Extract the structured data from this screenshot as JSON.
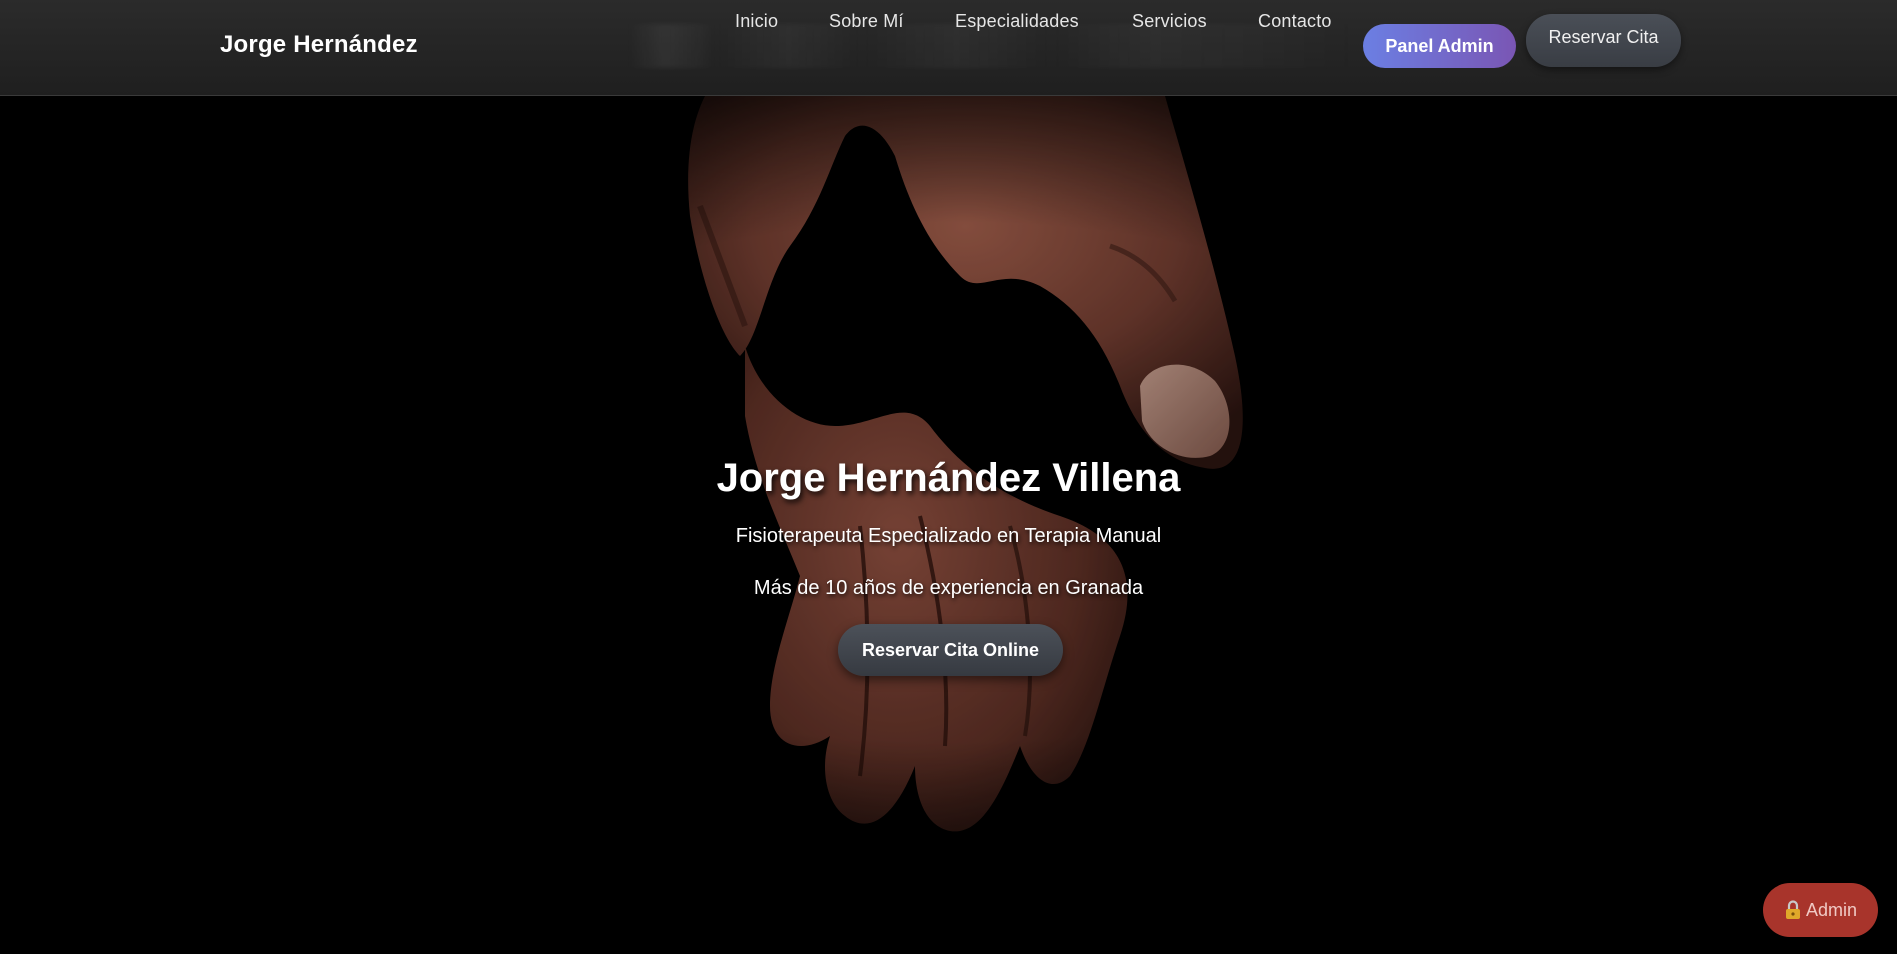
{
  "header": {
    "brand": "Jorge Hernández",
    "nav": [
      {
        "id": "inicio",
        "label": "Inicio"
      },
      {
        "id": "sobre-mi",
        "label": "Sobre Mí"
      },
      {
        "id": "especialidades",
        "label": "Especialidades"
      },
      {
        "id": "servicios",
        "label": "Servicios"
      },
      {
        "id": "contacto",
        "label": "Contacto"
      }
    ],
    "panel_admin_label": "Panel Admin",
    "reservar_label": "Reservar Cita"
  },
  "hero": {
    "title": "Jorge Hernández Villena",
    "subtitle": "Fisioterapeuta Especializado en Terapia Manual",
    "experience": "Más de 10 años de experiencia en Granada",
    "cta_label": "Reservar Cita Online",
    "background_icon": "hands-photo"
  },
  "floating_admin": {
    "icon": "lock-icon",
    "label": "Admin"
  },
  "colors": {
    "header_bg": "#252525",
    "hero_bg": "#000000",
    "panel_admin_gradient_start": "#6b7fe3",
    "panel_admin_gradient_end": "#7a56b4",
    "button_dark": "#40444b",
    "admin_float_bg": "#a8342b",
    "text": "#ffffff"
  }
}
